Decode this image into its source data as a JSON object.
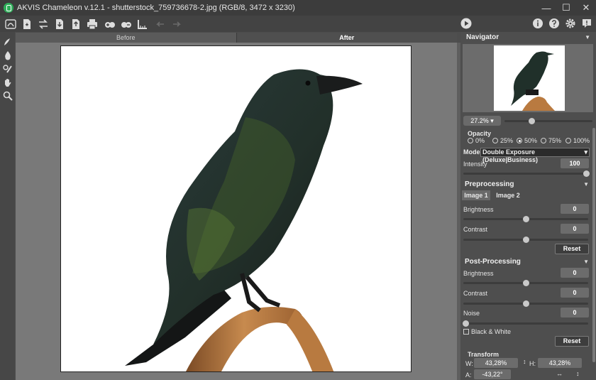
{
  "window": {
    "title": "AKVIS Chameleon v.12.1 - shutterstock_759736678-2.jpg (RGB/8, 3472 x 3230)",
    "controls": [
      "minimize-icon",
      "maximize-icon",
      "close-icon"
    ]
  },
  "toolbar": {
    "left_icons": [
      "home-icon",
      "open-file-icon",
      "swap-icon",
      "import-icon",
      "export-icon",
      "print-icon",
      "eye-plus-icon",
      "eye-minus-icon",
      "ruler-icon",
      "undo-icon",
      "redo-icon"
    ],
    "right_icons": [
      "play-icon",
      "info-icon",
      "help-icon",
      "settings-icon",
      "feedback-icon"
    ]
  },
  "left_tools": [
    "brush-icon",
    "drop-icon",
    "magic-brush-icon",
    "hand-icon",
    "zoom-icon"
  ],
  "view_tabs": {
    "before": "Before",
    "after": "After",
    "active": "After"
  },
  "navigator": {
    "title": "Navigator",
    "zoom": "27.2%",
    "zoom_slider": 0.3
  },
  "opacity": {
    "title": "Opacity",
    "options": [
      "0%",
      "25%",
      "50%",
      "75%",
      "100%"
    ],
    "selected": "50%"
  },
  "mode": {
    "label": "Mode",
    "value": "Double Exposure (Deluxe|Business)"
  },
  "intensity": {
    "label": "Intensity",
    "value": "100",
    "slider": 1.0
  },
  "preprocessing": {
    "title": "Preprocessing",
    "tabs": [
      "Image 1",
      "Image 2"
    ],
    "active_tab": "Image 1",
    "brightness_label": "Brightness",
    "brightness_value": "0",
    "contrast_label": "Contrast",
    "contrast_value": "0",
    "reset_label": "Reset"
  },
  "post_processing": {
    "title": "Post-Processing",
    "brightness_label": "Brightness",
    "brightness_value": "0",
    "contrast_label": "Contrast",
    "contrast_value": "0",
    "noise_label": "Noise",
    "noise_value": "0",
    "bw_label": "Black & White",
    "bw_checked": false,
    "reset_label": "Reset"
  },
  "transform": {
    "title": "Transform",
    "w_label": "W:",
    "w_value": "43,28%",
    "h_label": "H:",
    "h_value": "43,28%",
    "a_label": "A:",
    "a_value": "-43,22°"
  }
}
